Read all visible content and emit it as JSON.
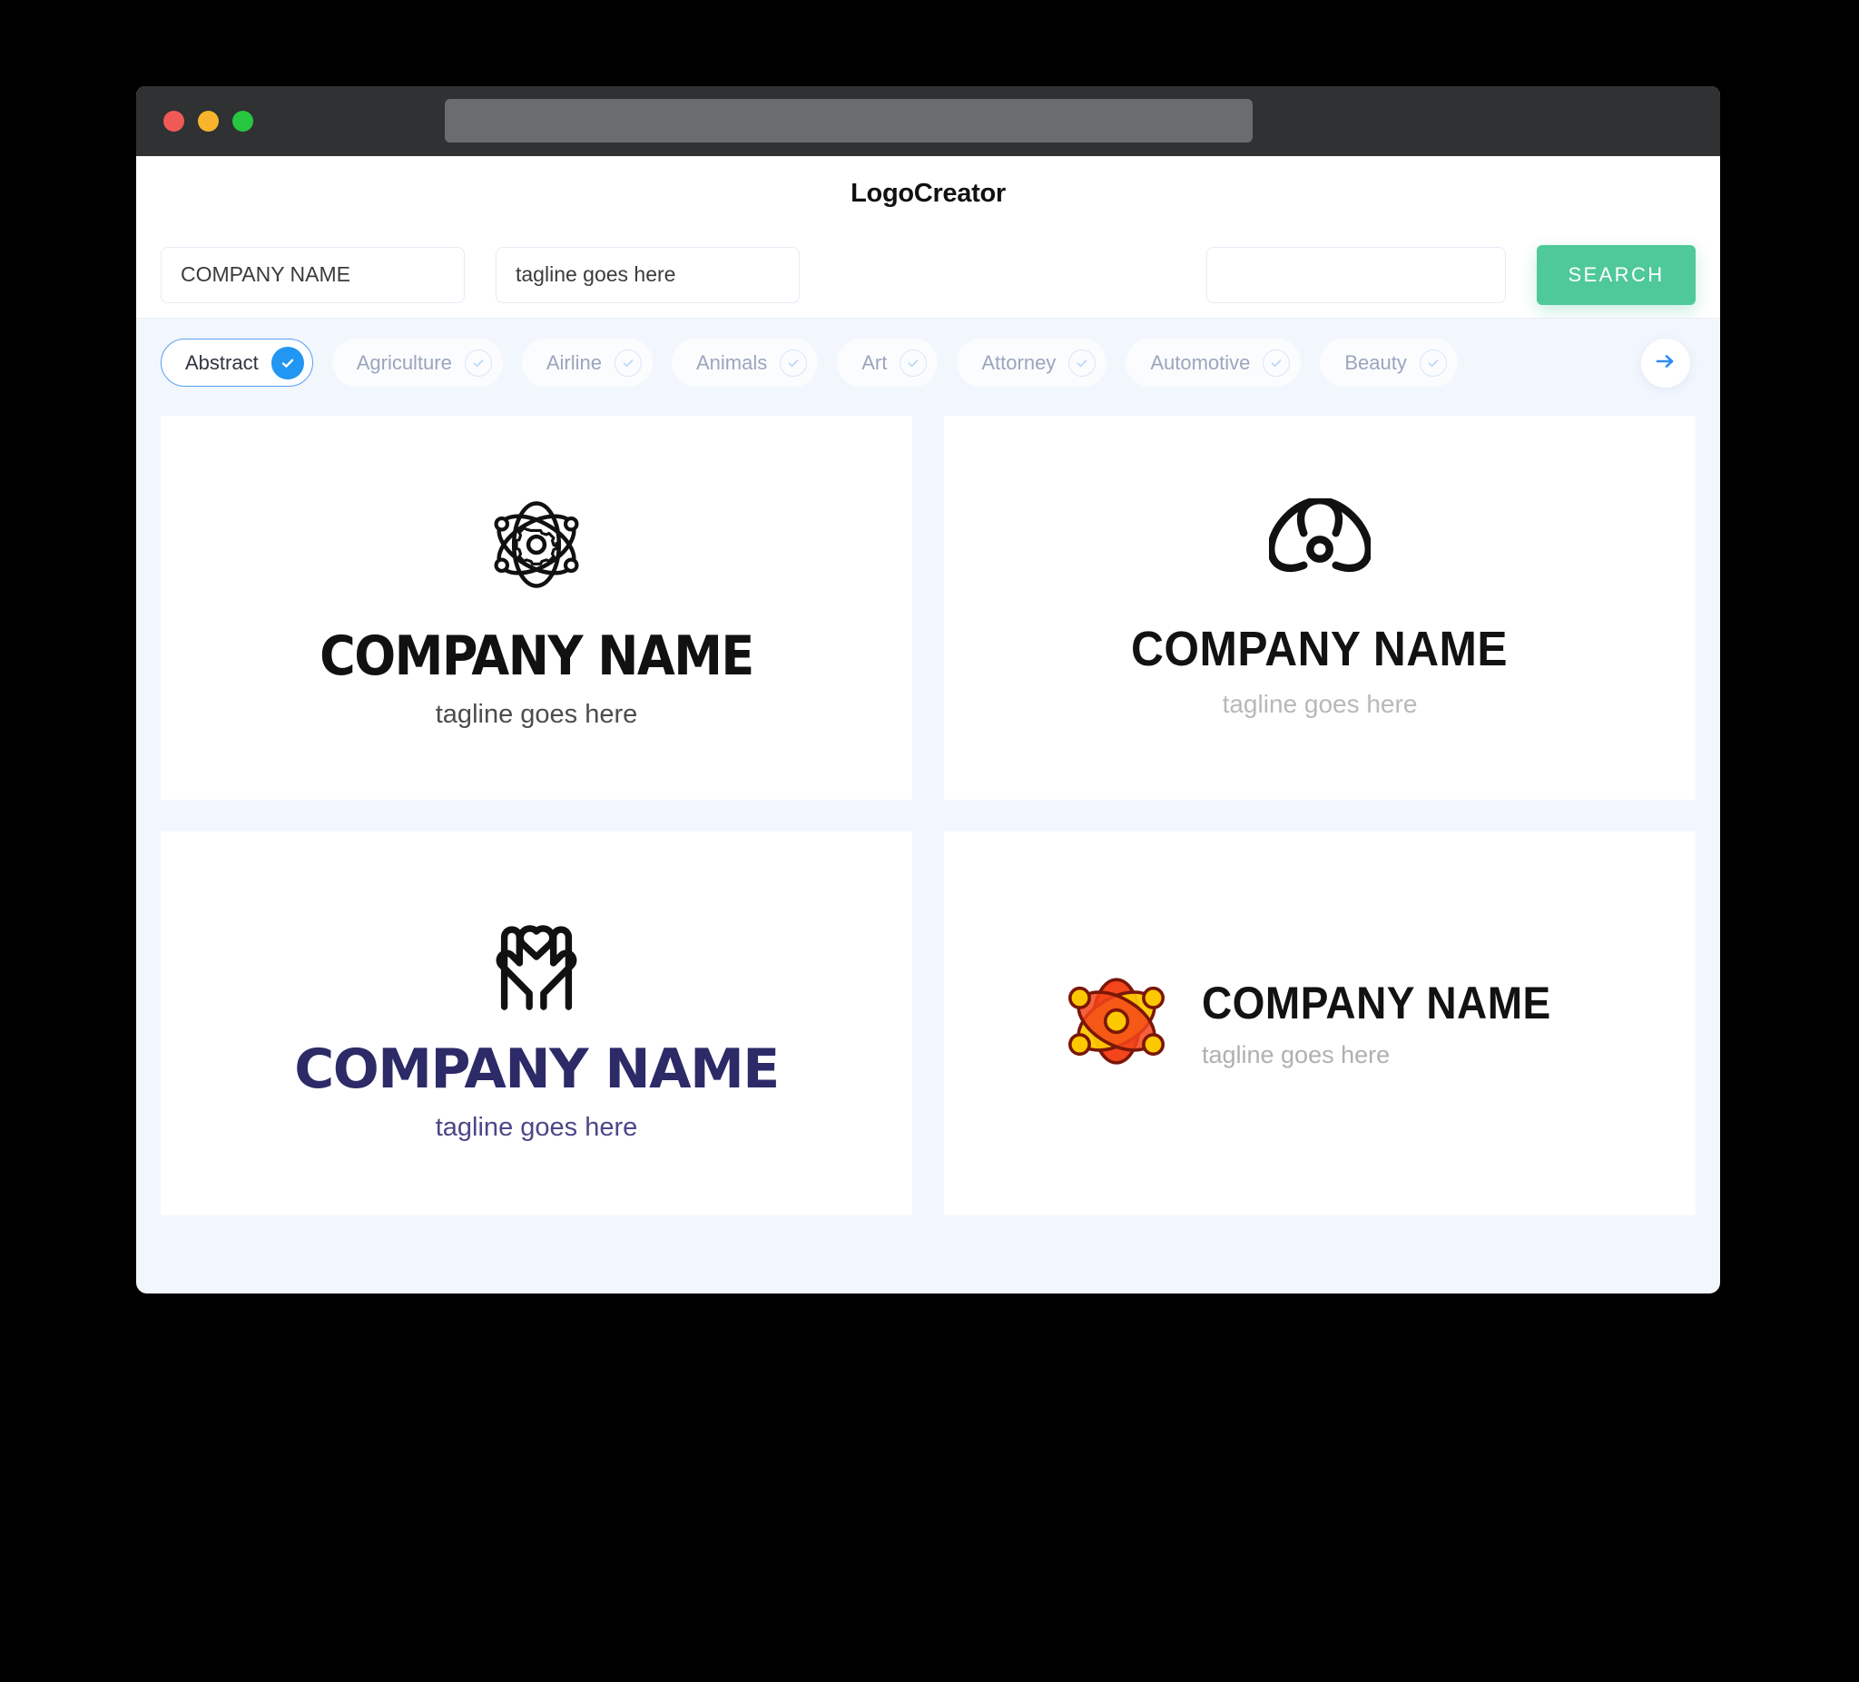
{
  "window": {
    "traffic_lights": [
      {
        "name": "close",
        "color": "#f05a56"
      },
      {
        "name": "minimize",
        "color": "#f7b42c"
      },
      {
        "name": "maximize",
        "color": "#27c63f"
      }
    ],
    "url_value": ""
  },
  "header": {
    "title": "LogoCreator"
  },
  "search": {
    "company_value": "COMPANY NAME",
    "company_placeholder": "COMPANY NAME",
    "tagline_value": "tagline goes here",
    "tagline_placeholder": "tagline goes here",
    "extra_value": "",
    "extra_placeholder": "",
    "button_label": "SEARCH",
    "button_color": "#4fc99a"
  },
  "categories": {
    "selected": "Abstract",
    "accent_color": "#2196f3",
    "items": [
      {
        "label": "Abstract",
        "selected": true
      },
      {
        "label": "Agriculture",
        "selected": false
      },
      {
        "label": "Airline",
        "selected": false
      },
      {
        "label": "Animals",
        "selected": false
      },
      {
        "label": "Art",
        "selected": false
      },
      {
        "label": "Attorney",
        "selected": false
      },
      {
        "label": "Automotive",
        "selected": false
      },
      {
        "label": "Beauty",
        "selected": false
      }
    ],
    "next_label": "next"
  },
  "logos": [
    {
      "id": "logo-atom-gear",
      "icon": "atom-gear-icon",
      "name": "COMPANY NAME",
      "tagline": "tagline goes here",
      "name_color": "#111111",
      "tagline_color": "#4c4c4c",
      "layout": "vertical"
    },
    {
      "id": "logo-atom-bold",
      "icon": "atom-orbit-icon",
      "name": "COMPANY NAME",
      "tagline": "tagline goes here",
      "name_color": "#121212",
      "tagline_color": "#b8b8b8",
      "layout": "vertical"
    },
    {
      "id": "logo-hands-heart",
      "icon": "hands-heart-icon",
      "name": "COMPANY NAME",
      "tagline": "tagline goes here",
      "name_color": "#2d2a68",
      "tagline_color": "#4a4789",
      "layout": "vertical"
    },
    {
      "id": "logo-atom-orange",
      "icon": "atom-orange-icon",
      "name": "COMPANY NAME",
      "tagline": "tagline goes here",
      "name_color": "#121212",
      "tagline_color": "#b0b0b0",
      "layout": "horizontal",
      "icon_colors": {
        "body": "#f5451a",
        "accent": "#fcc800",
        "outline": "#7a1708"
      }
    }
  ]
}
